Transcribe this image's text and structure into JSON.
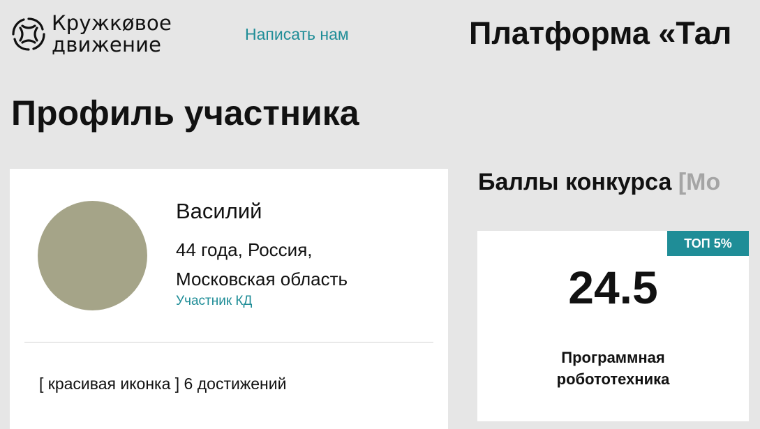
{
  "header": {
    "logo": {
      "line1": "Кружкøвое",
      "line2": "движение",
      "icon": "kruzhkovoe-logo-icon"
    },
    "write_us": "Написать нам",
    "platform_title": "Платформа «Тал"
  },
  "page": {
    "title": "Профиль участника"
  },
  "profile": {
    "name": "Василий",
    "meta_line1": "44 года, Россия,",
    "meta_line2": "Московская область",
    "status": "Участник КД",
    "avatar_color": "#a5a488",
    "achievements": "[ красивая иконка ] 6 достижений"
  },
  "scores": {
    "title": "Баллы конкурса",
    "title_muted": "[Мо",
    "card": {
      "badge": "ТОП 5%",
      "value": "24.5",
      "category_line1": "Программная",
      "category_line2": "робототехника"
    }
  },
  "colors": {
    "accent": "#1f8d97",
    "background": "#e6e6e6",
    "muted_text": "#a5a5a5"
  }
}
